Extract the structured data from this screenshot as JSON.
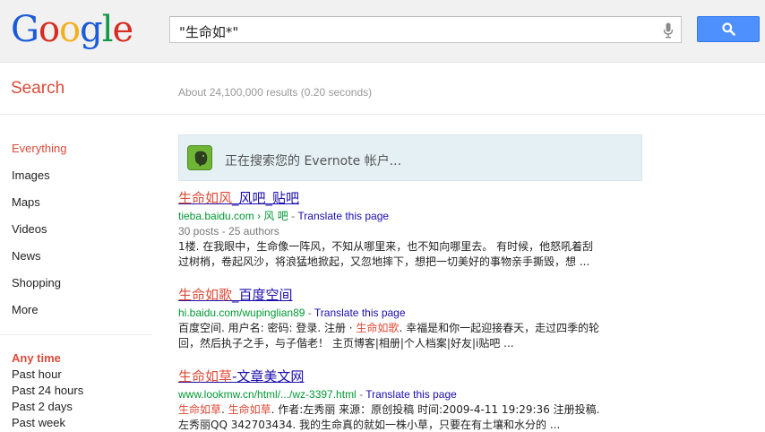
{
  "header": {
    "logo": [
      "G",
      "o",
      "o",
      "g",
      "l",
      "e"
    ],
    "logo_colors": [
      "#1a5bd8",
      "#d62d20",
      "#f2b01e",
      "#1a5bd8",
      "#109a48",
      "#d62d20"
    ],
    "query": "\"生命如*\""
  },
  "subbar": {
    "title": "Search",
    "stats": "About 24,100,000 results (0.20 seconds)"
  },
  "nav": {
    "items": [
      "Everything",
      "Images",
      "Maps",
      "Videos",
      "News",
      "Shopping",
      "More"
    ],
    "active_index": 0,
    "time_heading": "Any time",
    "time_items": [
      "Past hour",
      "Past 24 hours",
      "Past 2 days",
      "Past week"
    ]
  },
  "evernote": {
    "text": "正在搜索您的 Evernote 帐户..."
  },
  "results": [
    {
      "title_hl": "生命如风",
      "title_rest": "_风吧_贴吧",
      "url": "tieba.baidu.com › 风 吧",
      "translate": "Translate this page",
      "meta": "30 posts - 25 authors",
      "snippet1": "1楼. 在我眼中，生命像一阵风，不知从哪里来，也不知向哪里去。 有时候，他怒吼着刮",
      "snippet2": "过树梢，卷起风沙，将浪猛地掀起，又忽地摔下，想把一切美好的事物亲手撕毁，想 ..."
    },
    {
      "title_hl": "生命如歌",
      "title_rest": "_百度空间",
      "url": "hi.baidu.com/wupinglian89",
      "translate": "Translate this page",
      "meta": "",
      "snippet1_pre": "百度空间. 用户名: 密码: 登录. 注册 · ",
      "snippet1_hl": "生命如歌",
      "snippet1_post": ". 幸福是和你一起迎接春天，走过四季的轮",
      "snippet2": "回，然后执子之手，与子偕老！ 主页博客|相册|个人档案|好友|i贴吧 ..."
    },
    {
      "title_hl": "生命如草",
      "title_rest": "-文章美文网",
      "url": "www.lookmw.cn/html/.../wz-3397.html",
      "translate": "Translate this page",
      "meta": "",
      "snippet1_hl": "生命如草",
      "snippet1_sep": ". ",
      "snippet1_hl2": "生命如草",
      "snippet1_post": ". 作者:左秀丽 来源：原创投稿 时间:2009-4-11 19:29:36 注册投稿.",
      "snippet2": "左秀丽QQ 342703434. 我的生命真的就如一株小草，只要在有土壤和水分的 ..."
    }
  ]
}
